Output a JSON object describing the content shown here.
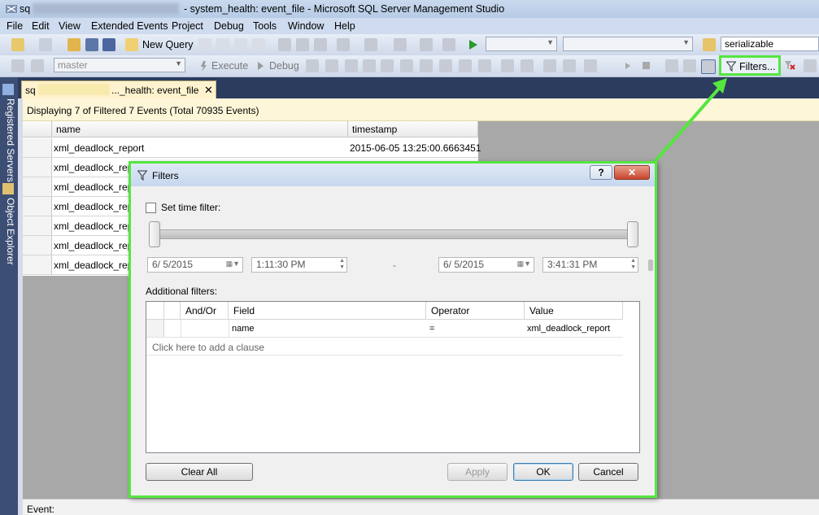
{
  "window": {
    "title_prefix": "sq",
    "title": "- system_health: event_file - Microsoft SQL Server Management Studio"
  },
  "menu": [
    "File",
    "Edit",
    "View",
    "Extended Events",
    "Project",
    "Debug",
    "Tools",
    "Window",
    "Help"
  ],
  "toolbar1": {
    "new_query": "New Query",
    "isolation": "serializable"
  },
  "toolbar2": {
    "database": "master",
    "execute": "Execute",
    "debug": "Debug",
    "filters": "Filters..."
  },
  "left_dock": {
    "registered_servers": "Registered Servers",
    "object_explorer": "Object Explorer"
  },
  "doc_tab": {
    "prefix": "sq",
    "label": "..._health: event_file"
  },
  "info_bar": "Displaying 7 of Filtered 7 Events (Total 70935 Events)",
  "grid": {
    "columns": [
      "name",
      "timestamp"
    ],
    "rows": [
      {
        "name": "xml_deadlock_report",
        "timestamp": "2015-06-05 13:25:00.6663451"
      },
      {
        "name": "xml_deadlock_report",
        "timestamp": ""
      },
      {
        "name": "xml_deadlock_report",
        "timestamp": ""
      },
      {
        "name": "xml_deadlock_report",
        "timestamp": ""
      },
      {
        "name": "xml_deadlock_report",
        "timestamp": ""
      },
      {
        "name": "xml_deadlock_report",
        "timestamp": ""
      },
      {
        "name": "xml_deadlock_report",
        "timestamp": ""
      }
    ]
  },
  "status_bar": "Event:",
  "dialog": {
    "title": "Filters",
    "set_time_filter": "Set time filter:",
    "start_date": "6/ 5/2015",
    "start_time": "1:11:30 PM",
    "separator": "-",
    "end_date": "6/ 5/2015",
    "end_time": "3:41:31 PM",
    "additional_filters": "Additional filters:",
    "columns": [
      "And/Or",
      "Field",
      "Operator",
      "Value"
    ],
    "rows": [
      {
        "andor": "",
        "field": "name",
        "operator": "=",
        "value": "xml_deadlock_report"
      }
    ],
    "add_clause": "Click here to add a clause",
    "clear_all": "Clear All",
    "apply": "Apply",
    "ok": "OK",
    "cancel": "Cancel",
    "help_glyph": "?"
  },
  "colors": {
    "highlight": "#55e640",
    "info_bar_bg": "#fdf6d9",
    "dock_bg": "#3c4e74"
  }
}
